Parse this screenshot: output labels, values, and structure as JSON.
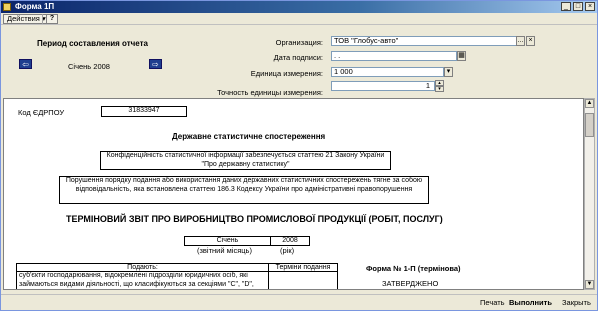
{
  "window": {
    "title": "Форма 1П",
    "minimize_label": "_",
    "maximize_label": "□",
    "close_label": "×"
  },
  "toolbar": {
    "actions_label": "Действия ▾",
    "help_label": "?"
  },
  "period": {
    "title": "Период составления отчета",
    "value": "Січень 2008",
    "prev_label": "⇦",
    "next_label": "⇨"
  },
  "form_fields": {
    "organization": {
      "label": "Организация:",
      "value": "ТОВ \"Глобус-авто\"",
      "select_label": "...",
      "clear_label": "×"
    },
    "sign_date": {
      "label": "Дата подписи:",
      "value": ". .",
      "calendar_label": "▦"
    },
    "unit": {
      "label": "Единица измерения:",
      "value": "1 000",
      "dropdown_label": "▾"
    },
    "precision": {
      "label": "Точность единицы измерения:",
      "value": "1",
      "spin_up": "▴",
      "spin_down": "▾"
    }
  },
  "document": {
    "edrpou_label": "Код ЄДРПОУ",
    "edrpou_value": "31833947",
    "heading": "Державне статистичне спостереження",
    "confidentiality": "Конфіденційність статистичної інформації забезпечується статтею 21 Закону України \"Про державну статистику\"",
    "violation": "Порушення порядку подання або використання даних державних статистичних спостережень тягне за собою відповідальність, яка встановлена статтею 186.3 Кодексу України про адміністративні правопорушення",
    "report_title": "ТЕРМІНОВИЙ ЗВІТ ПРО ВИРОБНИЦТВО ПРОМИСЛОВОЇ ПРОДУКЦІЇ (РОБІТ, ПОСЛУГ)",
    "month_value": "Січень",
    "year_value": "2008",
    "month_caption": "(звітний місяць)",
    "year_caption": "(рік)",
    "submit_header": "Подають:",
    "deadline_header": "Терміни подання",
    "submit_text": "суб'єкти господарювання, відокремлені підрозділи юридичних осіб, які займаються видами діяльності, що класифікуються за секціями \"С\", \"D\",",
    "form_label": "Форма № 1-П (термінова)",
    "approved_label": "ЗАТВЕРДЖЕНО"
  },
  "statusbar": {
    "print_label": "Печать",
    "execute_label": "Выполнить",
    "close_label": "Закрыть"
  }
}
